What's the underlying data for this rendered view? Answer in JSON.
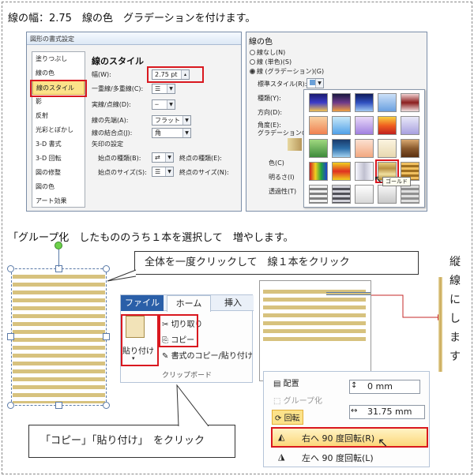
{
  "captions": {
    "top": "線の幅：2.75　線の色　グラデーションを付けます。",
    "middle": "「グループ化　したもののうち１本を選択して　増やします。",
    "callout1": "全体を一度クリックして　線１本をクリック",
    "callout2": "「コピー」「貼り付け」　をクリック"
  },
  "vertical_note": [
    "縦",
    "線",
    "に",
    "し",
    "ま",
    "す"
  ],
  "format_dialog": {
    "title": "図形の書式設定",
    "categories": [
      "塗りつぶし",
      "線の色",
      "線のスタイル",
      "影",
      "反射",
      "光彩とぼかし",
      "3-D 書式",
      "3-D 回転",
      "図の修整",
      "図の色",
      "アート効果"
    ],
    "selected_index": 2,
    "section_title": "線のスタイル",
    "width_label": "幅(W):",
    "width_value": "2.75 pt",
    "compound_label": "一重線/多重線(C):",
    "dash_label": "実線/点線(D):",
    "cap_label": "線の先端(A):",
    "cap_value": "フラット",
    "join_label": "線の結合点(J):",
    "join_value": "角",
    "arrow_title": "矢印の設定",
    "begin_type_label": "始点の種類(B):",
    "end_type_label": "終点の種類(E):",
    "begin_size_label": "始点のサイズ(S):",
    "end_size_label": "終点のサイズ(N):"
  },
  "color_panel": {
    "title": "線の色",
    "opt_none": "線なし(N)",
    "opt_solid": "線 (単色)(S)",
    "opt_gradient": "線 (グラデーション)(G)",
    "preset_label": "標準スタイル(R):",
    "type_label": "種類(Y):",
    "direction_label": "方向(D):",
    "angle_label": "角度(E):",
    "stops_label": "グラデーションの分布",
    "color_label": "色(C)",
    "brightness_label": "明るさ(I)",
    "transparency_label": "透過性(T)",
    "tooltip": "ゴールド",
    "swatches": [
      [
        "#1b2a8a",
        "#2a1f6e",
        "#2c3c9a",
        "#9fc2e8",
        "#8b1e1e"
      ],
      [
        "#f5a86a",
        "#7fb9f0",
        "#b7a9ea",
        "#f0883a",
        "#c9c2ea"
      ],
      [
        "#3d8a3a",
        "#2c6ea9",
        "#f3b89a",
        "#f0e6c8",
        "#8a5a2e"
      ],
      [
        "#e8d24a",
        "#d23a2a",
        "#e0e0e8",
        "#c8a858",
        "#d0a040"
      ],
      [
        "#a8a8a8",
        "#686870",
        "#f0f0f0",
        "#e8e8e8",
        "#a0a0a0"
      ]
    ]
  },
  "ribbon": {
    "file_tab": "ファイル",
    "home_tab": "ホーム",
    "insert_tab": "挿入",
    "paste_label": "貼り付け",
    "cut_label": "切り取り",
    "copy_label": "コピー",
    "format_painter_label": "書式のコピー/貼り付け",
    "group_label": "クリップボード"
  },
  "arrange_panel": {
    "arrange_label": "配置",
    "group_label": "グループ化",
    "rotate_label": "回転",
    "height_value": "0 mm",
    "width_value": "31.75 mm",
    "rotate_right": "右へ 90 度回転(R)",
    "rotate_left": "左へ 90 度回転(L)"
  }
}
